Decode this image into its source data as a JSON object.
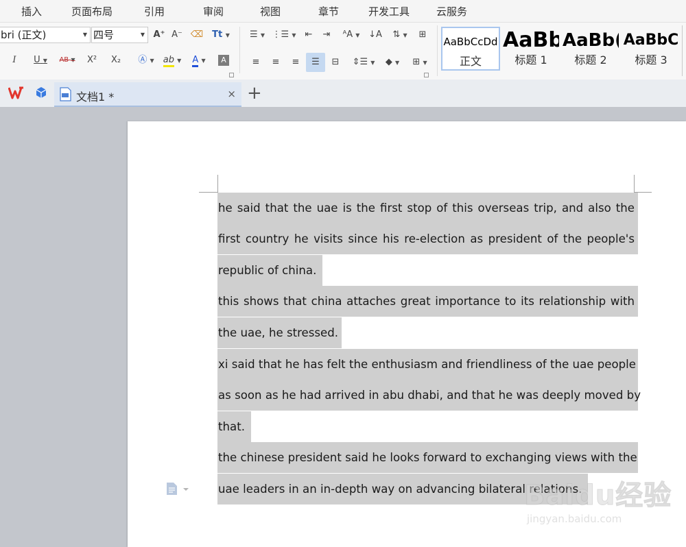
{
  "menu": [
    "插入",
    "页面布局",
    "引用",
    "审阅",
    "视图",
    "章节",
    "开发工具",
    "云服务"
  ],
  "ribbon": {
    "font_name": "bri (正文)",
    "font_size": "四号",
    "grow_font": "A⁺",
    "shrink_font": "A⁻",
    "bold_u": "U",
    "italic": "I",
    "strike": "AB",
    "superscript": "X²",
    "subscript": "X₂",
    "font_color": "A",
    "char_shade": "A",
    "highlight": "ab"
  },
  "styles": [
    {
      "sample": "AaBbCcDd",
      "name": "正文"
    },
    {
      "sample": "AaBb",
      "name": "标题 1"
    },
    {
      "sample": "AaBb(",
      "name": "标题 2"
    },
    {
      "sample": "AaBbC",
      "name": "标题 3"
    }
  ],
  "tab": {
    "title": "文档1 *",
    "close": "×",
    "new": "+"
  },
  "document": {
    "lines": [
      "he said that the uae is the first stop of this overseas trip, and also the",
      "first country he visits since his re-election as president of the people's",
      "republic of china.",
      "this shows that china attaches great importance to its relationship with",
      "the uae, he stressed.",
      "xi said that he has felt the enthusiasm and friendliness of the uae people",
      "as soon as he had arrived in abu dhabi, and that he was deeply moved by",
      "that.",
      "the chinese president said he looks forward to exchanging views with the",
      "uae leaders in an in-depth way on advancing bilateral relations."
    ]
  },
  "watermark": {
    "main": "Baidu经验",
    "sub": "jingyan.baidu.com"
  },
  "colors": {
    "selection": "#cfcfcf",
    "accent": "#4a7fd4",
    "wps_red": "#e2362d"
  }
}
